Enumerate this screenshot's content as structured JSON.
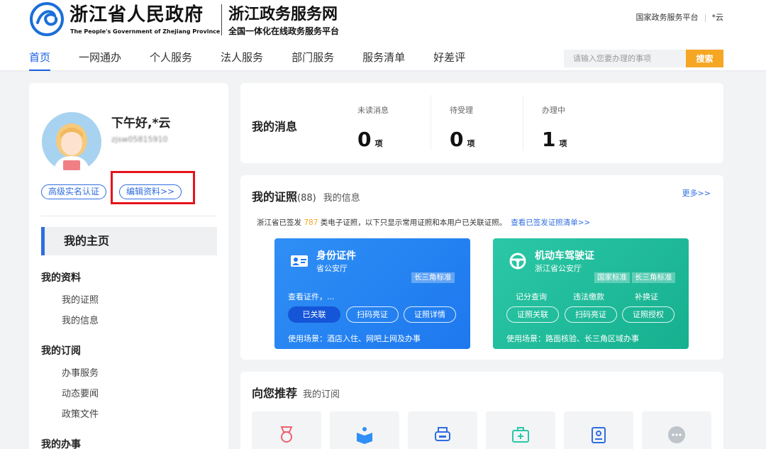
{
  "header": {
    "logo_cn": "浙江省人民政府",
    "logo_en": "The People's Government of Zhejiang Province",
    "site_name": "浙江政务服务网",
    "site_sub": "全国一体化在线政务服务平台",
    "links": [
      "国家政务服务平台",
      "*云"
    ]
  },
  "nav": {
    "items": [
      "首页",
      "一网通办",
      "个人服务",
      "法人服务",
      "部门服务",
      "服务清单",
      "好差评"
    ],
    "active": "首页"
  },
  "search": {
    "placeholder": "请输入您要办理的事项",
    "button_label": "搜索"
  },
  "profile": {
    "greeting": "下午好,*云",
    "username_masked": "zjsw05815910",
    "realname_button": "高级实名认证",
    "edit_button": "编辑资料>>",
    "home_label": "我的主页"
  },
  "menu": {
    "groups": [
      {
        "title": "我的资料",
        "items": [
          "我的证照",
          "我的信息"
        ]
      },
      {
        "title": "我的订阅",
        "items": [
          "办事服务",
          "动态要闻",
          "政策文件"
        ]
      },
      {
        "title": "我的办事",
        "items": []
      }
    ]
  },
  "messages": {
    "title": "我的消息",
    "stats": [
      {
        "label": "未读消息",
        "value": "0",
        "unit": "项"
      },
      {
        "label": "待受理",
        "value": "0",
        "unit": "项"
      },
      {
        "label": "办理中",
        "value": "1",
        "unit": "项"
      }
    ]
  },
  "certificates": {
    "title": "我的证照",
    "count": "(88)",
    "alt_tab": "我的信息",
    "more": "更多>>",
    "note_prefix": "浙江省已签发",
    "note_number": "787",
    "note_suffix": "类电子证照，以下只显示常用证照和本用户已关联证照。",
    "note_link": "查看已签发证照清单>>",
    "cards": [
      {
        "name": "身份证件",
        "org": "省公安厅",
        "tags": [
          "长三角标准"
        ],
        "hint": "查看证件，...",
        "actions": [],
        "buttons": [
          "已关联",
          "扫码亮证",
          "证照详情"
        ],
        "scene": "使用场景：酒店入住、网吧上网及办事",
        "color": "#1d78ee"
      },
      {
        "name": "机动车驾驶证",
        "org": "浙江省公安厅",
        "tags": [
          "国家标准",
          "长三角标准"
        ],
        "hint": "",
        "actions": [
          "记分查询",
          "违法缴款",
          "补换证"
        ],
        "buttons": [
          "证照关联",
          "扫码亮证",
          "证照授权"
        ],
        "scene": "使用场景：路面核验、长三角区域办事",
        "color": "#16b08f"
      }
    ]
  },
  "recommend": {
    "title": "向您推荐",
    "alt_tab": "我的订阅",
    "tiles": [
      {
        "icon": "medal-icon",
        "color": "#f0626f"
      },
      {
        "icon": "book-icon",
        "color": "#2f8ff5"
      },
      {
        "icon": "printer-icon",
        "color": "#2f6de1"
      },
      {
        "icon": "medical-kit-icon",
        "color": "#2bc7a6"
      },
      {
        "icon": "id-badge-icon",
        "color": "#2f6de1"
      },
      {
        "icon": "more-icon",
        "color": "#bfc3ca"
      }
    ]
  },
  "colors": {
    "brand_blue": "#1a5fe0",
    "search_orange": "#f5a623",
    "highlight_red": "#e5141b"
  }
}
